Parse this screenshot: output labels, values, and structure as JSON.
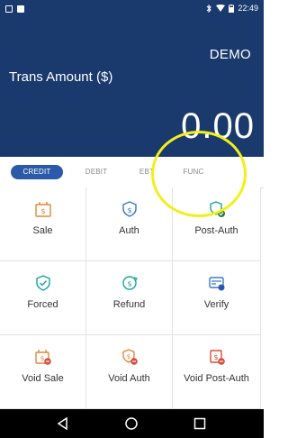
{
  "status_bar": {
    "time": "22:49"
  },
  "header": {
    "demo_label": "DEMO",
    "amount_label": "Trans Amount ($)",
    "amount_value": "0.00"
  },
  "tabs": [
    {
      "label": "CREDIT",
      "active": true
    },
    {
      "label": "DEBIT",
      "active": false
    },
    {
      "label": "EBT",
      "active": false
    },
    {
      "label": "FUNC",
      "active": false
    }
  ],
  "actions": [
    {
      "label": "Sale",
      "icon": "sale-icon"
    },
    {
      "label": "Auth",
      "icon": "auth-icon"
    },
    {
      "label": "Post-Auth",
      "icon": "post-auth-icon"
    },
    {
      "label": "Forced",
      "icon": "forced-icon"
    },
    {
      "label": "Refund",
      "icon": "refund-icon"
    },
    {
      "label": "Verify",
      "icon": "verify-icon"
    },
    {
      "label": "Void Sale",
      "icon": "void-sale-icon"
    },
    {
      "label": "Void Auth",
      "icon": "void-auth-icon"
    },
    {
      "label": "Void Post-Auth",
      "icon": "void-post-auth-icon"
    }
  ],
  "colors": {
    "header_bg": "#1a3a6e",
    "tab_active": "#2a5aa8",
    "icon_orange": "#e0883a",
    "icon_teal": "#1aa59a",
    "icon_blue": "#3a78c8",
    "icon_red": "#d84a3a",
    "highlight": "#f4ef1b"
  }
}
